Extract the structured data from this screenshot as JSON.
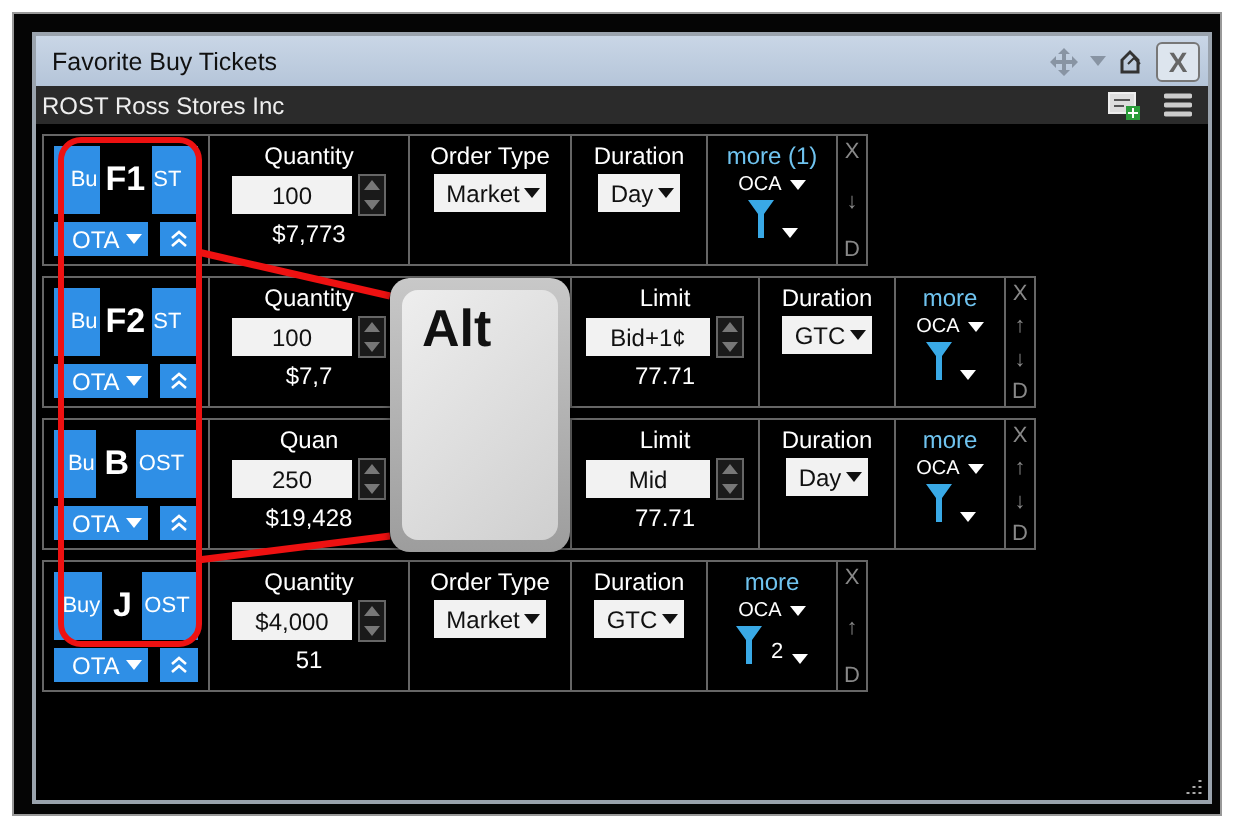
{
  "window": {
    "title": "Favorite Buy Tickets",
    "close": "X"
  },
  "symbol_bar": {
    "text": "ROST Ross Stores Inc"
  },
  "tickets": [
    {
      "hotkey": "F1",
      "buy_left": "Bu",
      "buy_right": "ST",
      "ota": "OTA",
      "cells": [
        {
          "kind": "quantity",
          "label": "Quantity",
          "value": "100",
          "amount": "$7,773"
        },
        {
          "kind": "select",
          "label": "Order Type",
          "value": "Market"
        },
        {
          "kind": "duration",
          "label": "Duration",
          "value": "Day"
        }
      ],
      "more": {
        "label": "more (1)",
        "oca": "OCA"
      },
      "side": [
        "X",
        "↓",
        "D"
      ]
    },
    {
      "hotkey": "F2",
      "buy_left": "Bu",
      "buy_right": "ST",
      "ota": "OTA",
      "cells": [
        {
          "kind": "quantity",
          "label": "Quantity",
          "value": "100",
          "amount": "$7,7"
        },
        {
          "kind": "blank"
        },
        {
          "kind": "limit",
          "label": "Limit",
          "value": "Bid+1¢",
          "amount": "77.71"
        },
        {
          "kind": "duration",
          "label": "Duration",
          "value": "GTC"
        }
      ],
      "more": {
        "label": "more",
        "oca": "OCA"
      },
      "side": [
        "X",
        "↑",
        "↓",
        "D"
      ]
    },
    {
      "hotkey": "B",
      "buy_left": "Bu",
      "buy_right": "OST",
      "ota": "OTA",
      "cells": [
        {
          "kind": "quantity",
          "label": "Quan",
          "value": "250",
          "amount": "$19,428"
        },
        {
          "kind": "blank"
        },
        {
          "kind": "limit",
          "label": "Limit",
          "value": "Mid",
          "amount": "77.71"
        },
        {
          "kind": "duration",
          "label": "Duration",
          "value": "Day"
        }
      ],
      "more": {
        "label": "more",
        "oca": "OCA"
      },
      "side": [
        "X",
        "↑",
        "↓",
        "D"
      ]
    },
    {
      "hotkey": "J",
      "buy_left": "Buy",
      "buy_right": "OST",
      "ota": "OTA",
      "cells": [
        {
          "kind": "quantity",
          "label": "Quantity",
          "value": "$4,000",
          "amount": "51"
        },
        {
          "kind": "select",
          "label": "Order Type",
          "value": "Market"
        },
        {
          "kind": "duration",
          "label": "Duration",
          "value": "GTC"
        }
      ],
      "more": {
        "label": "more",
        "oca": "OCA",
        "filter_count": "2"
      },
      "side": [
        "X",
        "↑",
        "D"
      ]
    }
  ],
  "key_callout": {
    "key": "Alt"
  }
}
